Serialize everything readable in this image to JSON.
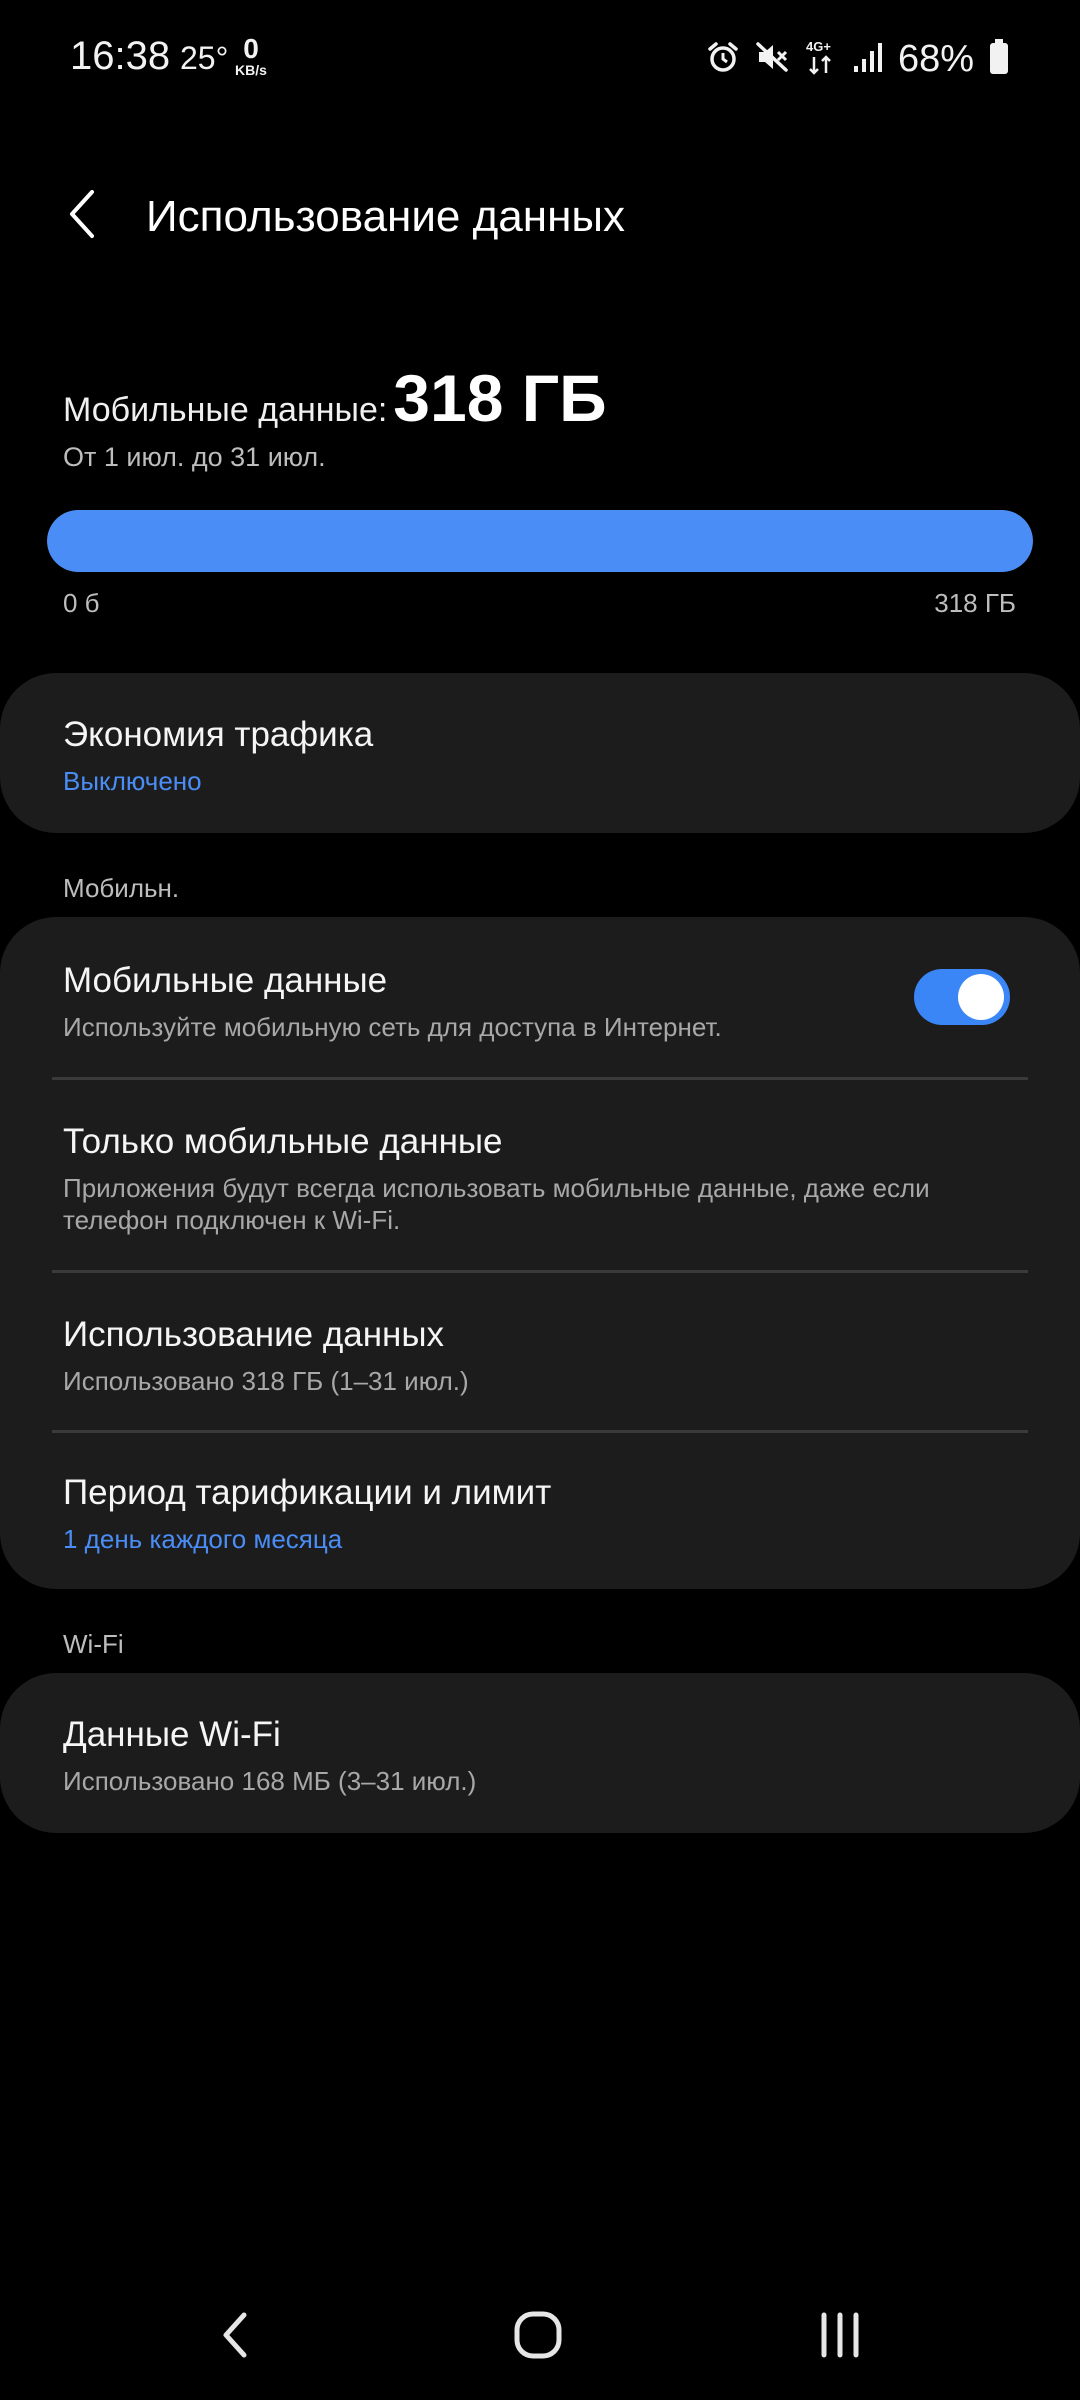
{
  "status_bar": {
    "time": "16:38",
    "temperature": "25°",
    "net_speed_value": "0",
    "net_speed_unit": "KB/s",
    "network_type": "4G+",
    "battery_percent": "68%",
    "icons": [
      "alarm-icon",
      "vibrate-mute-icon",
      "mobile-data-arrows-icon",
      "signal-icon",
      "battery-icon"
    ]
  },
  "header": {
    "title": "Использование данных"
  },
  "summary": {
    "label": "Мобильные данные:",
    "value": "318 ГБ",
    "period": "От 1 июл. до 31 июл.",
    "bar_min": "0 б",
    "bar_max": "318 ГБ",
    "usage_fraction": 1.0,
    "bar_color": "#4a8df6"
  },
  "data_saver": {
    "title": "Экономия трафика",
    "status": "Выключено"
  },
  "mobile_section": {
    "label": "Мобильн.",
    "items": [
      {
        "title": "Мобильные данные",
        "subtitle": "Используйте мобильную сеть для доступа в Интернет.",
        "toggle_on": true
      },
      {
        "title": "Только мобильные данные",
        "subtitle": "Приложения будут всегда использовать мобильные данные, даже если телефон подключен к Wi-Fi."
      },
      {
        "title": "Использование данных",
        "subtitle": "Использовано 318 ГБ (1–31 июл.)"
      },
      {
        "title": "Период тарификации и лимит",
        "subtitle": "1 день каждого месяца"
      }
    ]
  },
  "wifi_section": {
    "label": "Wi-Fi",
    "items": [
      {
        "title": "Данные Wi-Fi",
        "subtitle": "Использовано 168 МБ (3–31 июл.)"
      }
    ]
  },
  "nav_bar": {
    "buttons": [
      "back-nav-icon",
      "home-nav-icon",
      "recents-nav-icon"
    ]
  },
  "colors": {
    "accent": "#4a8df6",
    "background": "#000000",
    "card": "#1c1c1c"
  }
}
